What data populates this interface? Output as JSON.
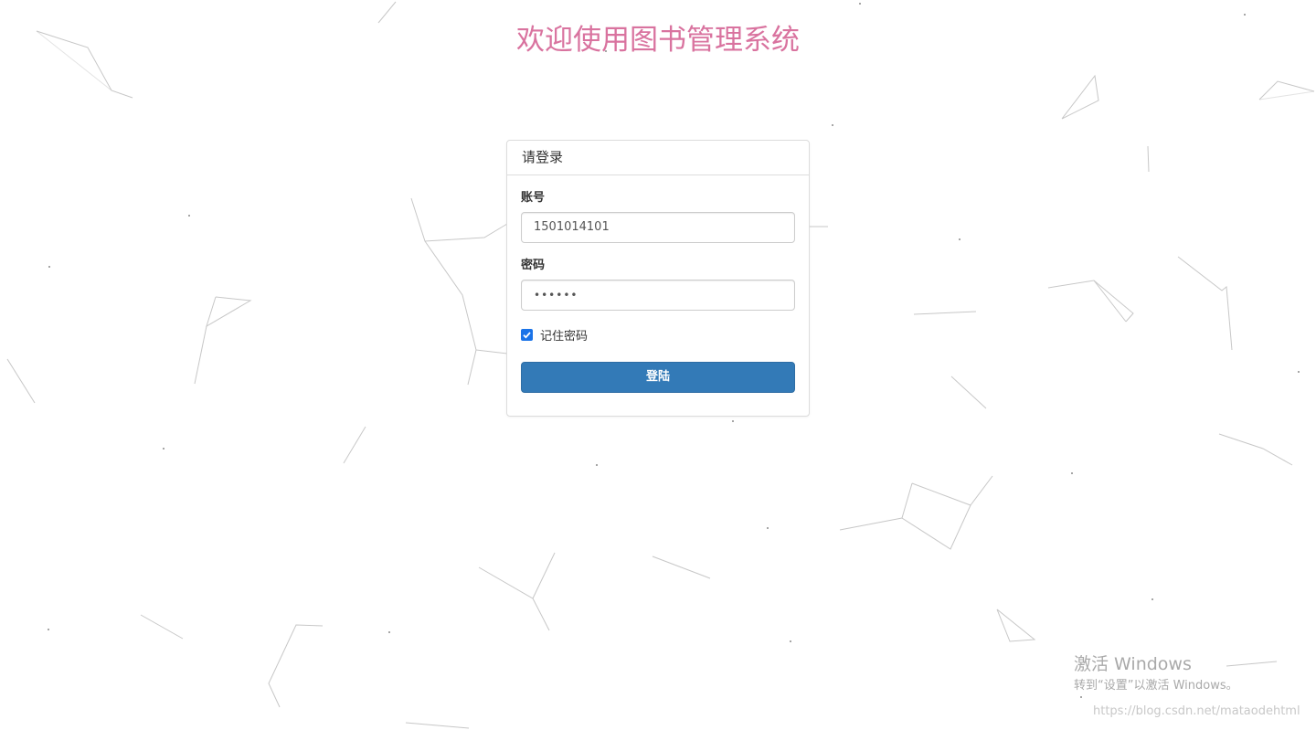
{
  "page": {
    "title": "欢迎使用图书管理系统"
  },
  "login": {
    "heading": "请登录",
    "account_label": "账号",
    "account_value": "1501014101",
    "password_label": "密码",
    "password_value": "••••••",
    "remember_label": "记住密码",
    "remember_checked": true,
    "submit_label": "登陆"
  },
  "overlay": {
    "activate_title": "激活 Windows",
    "activate_hint": "转到“设置”以激活 Windows。",
    "credit": "https://blog.csdn.net/mataodehtml"
  },
  "colors": {
    "title": "#d9739f",
    "button": "#337ab7",
    "checkbox": "#1a73e8"
  }
}
